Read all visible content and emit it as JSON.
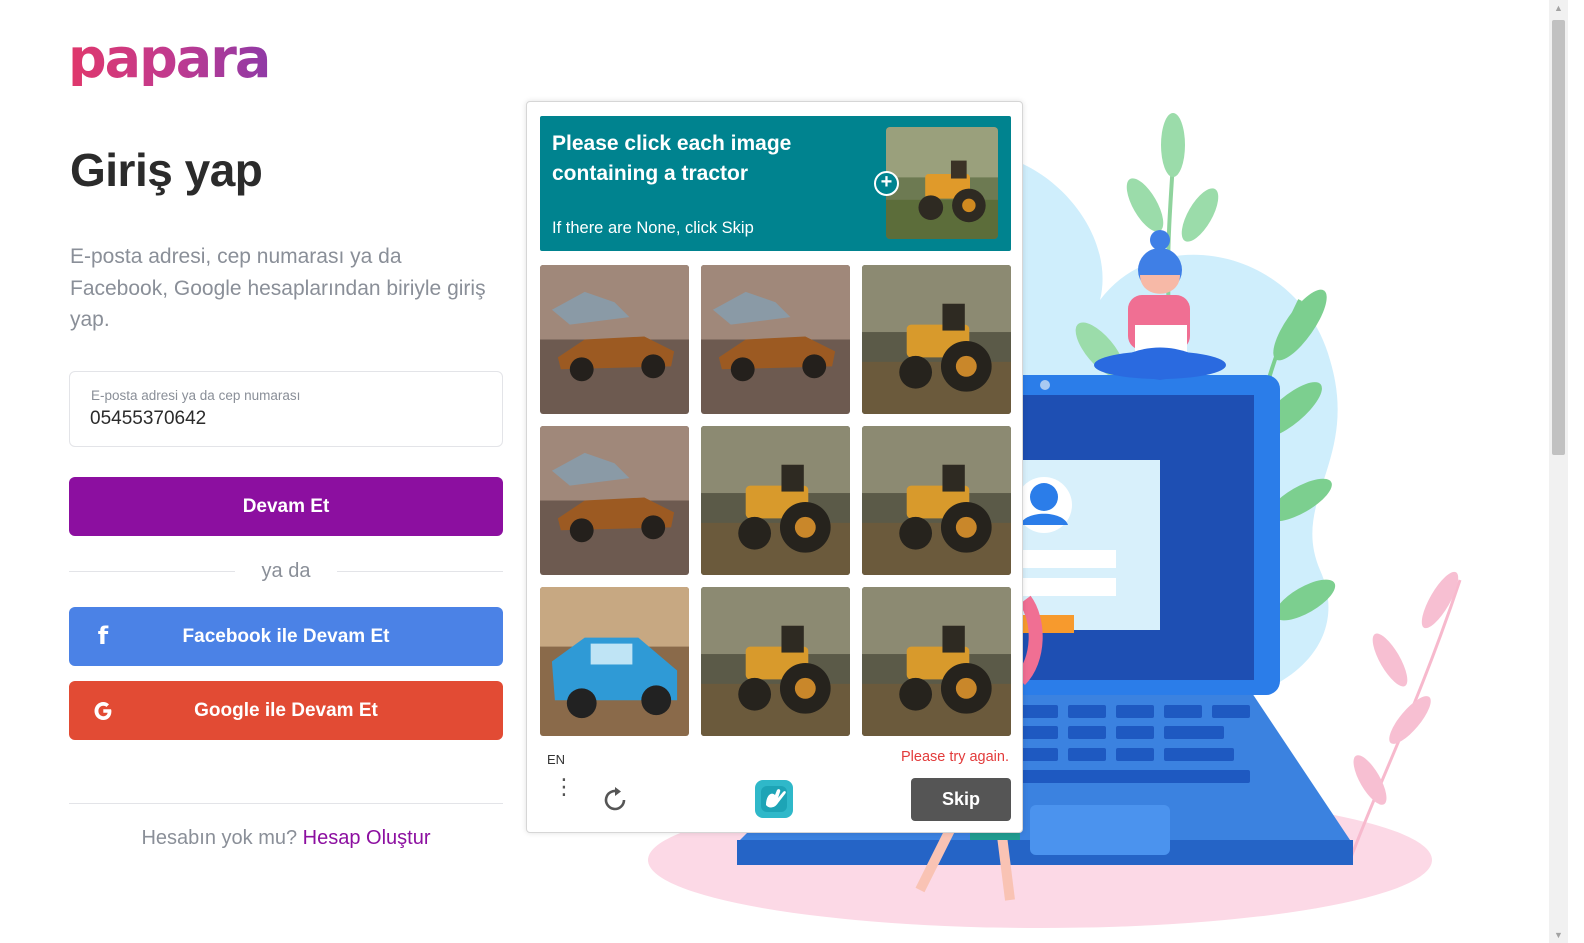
{
  "brand": {
    "logo_text": "papara",
    "accent_color": "#8c0fa0"
  },
  "login": {
    "title": "Giriş yap",
    "subtitle": "E-posta adresi, cep numarası ya da Facebook, Google hesaplarından biriyle giriş yap.",
    "field_label": "E-posta adresi ya da cep numarası",
    "field_value": "05455370642",
    "continue_label": "Devam Et",
    "or_label": "ya da",
    "facebook_label": "Facebook ile Devam Et",
    "google_label": "Google ile Devam Et",
    "no_account_text": "Hesabın yok mu?",
    "create_account_link": "Hesap Oluştur"
  },
  "captcha": {
    "prompt": "Please click each image containing a tractor",
    "hint": "If there are None, click Skip",
    "language": "EN",
    "error": "Please try again.",
    "skip_label": "Skip",
    "example_icon": "tractor-image",
    "tiles": [
      {
        "content": "car",
        "selected": false
      },
      {
        "content": "car",
        "selected": false
      },
      {
        "content": "tractor",
        "selected": false
      },
      {
        "content": "car",
        "selected": false
      },
      {
        "content": "tractor",
        "selected": false
      },
      {
        "content": "tractor",
        "selected": false
      },
      {
        "content": "toy-car",
        "selected": false
      },
      {
        "content": "tractor",
        "selected": false
      },
      {
        "content": "tractor",
        "selected": false
      }
    ],
    "colors": {
      "header": "#00838f",
      "error": "#e23b3b",
      "skip_button": "#555555"
    }
  },
  "colors": {
    "facebook": "#4b82e6",
    "google": "#e24b34",
    "muted_text": "#8a8f98"
  }
}
